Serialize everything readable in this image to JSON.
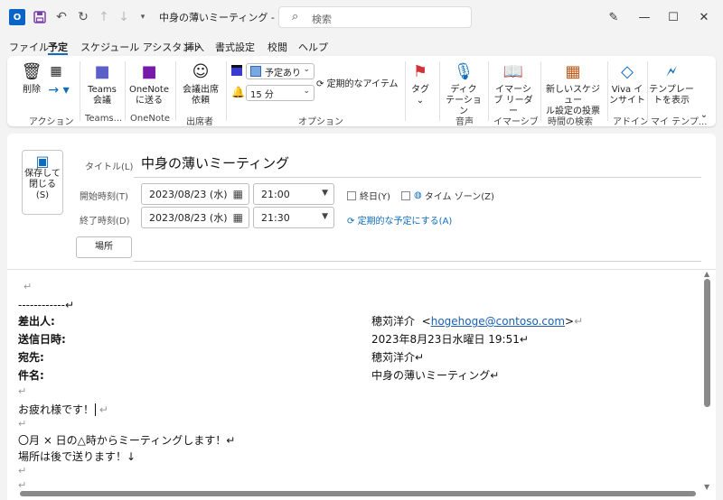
{
  "titlebar": {
    "app_logo": "O",
    "title": "中身の薄いミーティング - ...",
    "search_placeholder": "検索"
  },
  "tabs": [
    "ファイル",
    "予定",
    "スケジュール アシスタント",
    "挿入",
    "書式設定",
    "校閲",
    "ヘルプ"
  ],
  "ribbon": {
    "delete": "削除",
    "teams_line1": "Teams",
    "teams_line2": "会議",
    "onenote_line1": "OneNote",
    "onenote_line2": "に送る",
    "invite_line1": "会議出席",
    "invite_line2": "依頼",
    "show_as": "予定あり",
    "reminder": "15 分",
    "recurrence": "定期的なアイテム",
    "tag": "タグ",
    "dictate_line1": "ディク",
    "dictate_line2": "テーション",
    "reader_line1": "イマーシ",
    "reader_line2": "ブ リーダー",
    "newsched_line1": "新しいスケジュー",
    "newsched_line2": "ル設定の投票",
    "viva_line1": "Viva イ",
    "viva_line2": "ンサイト",
    "template_line1": "テンプレー",
    "template_line2": "トを表示",
    "groups": [
      "アクション",
      "Teams...",
      "OneNote",
      "出席者",
      "オプション",
      "音声",
      "イマーシブ",
      "時間の検索",
      "アドイン",
      "マイ テンプ..."
    ]
  },
  "form": {
    "save_close_line1": "保存して",
    "save_close_line2": "閉じる",
    "save_close_line3": "(S)",
    "title_label": "タイトル(L)",
    "title_value": "中身の薄いミーティング",
    "start_label": "開始時刻(T)",
    "start_date": "2023/08/23 (水)",
    "start_time": "21:00",
    "end_label": "終了時刻(D)",
    "end_date": "2023/08/23 (水)",
    "end_time": "21:30",
    "allday": "終日(Y)",
    "timezone": "タイム ゾーン(Z)",
    "recur_link": "定期的な予定にする(A)",
    "location_button": "場所"
  },
  "mail": {
    "mark": "↵",
    "separator": "------------↵",
    "from_label": "差出人:",
    "from_name": "穂苅洋介",
    "from_email": "hogehoge@contoso.com",
    "sent_label": "送信日時:",
    "sent_value": "2023年8月23日水曜日 19:51↵",
    "to_label": "宛先:",
    "to_value": "穂苅洋介↵",
    "subject_label": "件名:",
    "subject_value": "中身の薄いミーティング↵",
    "greeting": "お疲れ様です！",
    "line1": "〇月 × 日の△時からミーティングします！↵",
    "line2": "場所は後で送ります！↓"
  }
}
